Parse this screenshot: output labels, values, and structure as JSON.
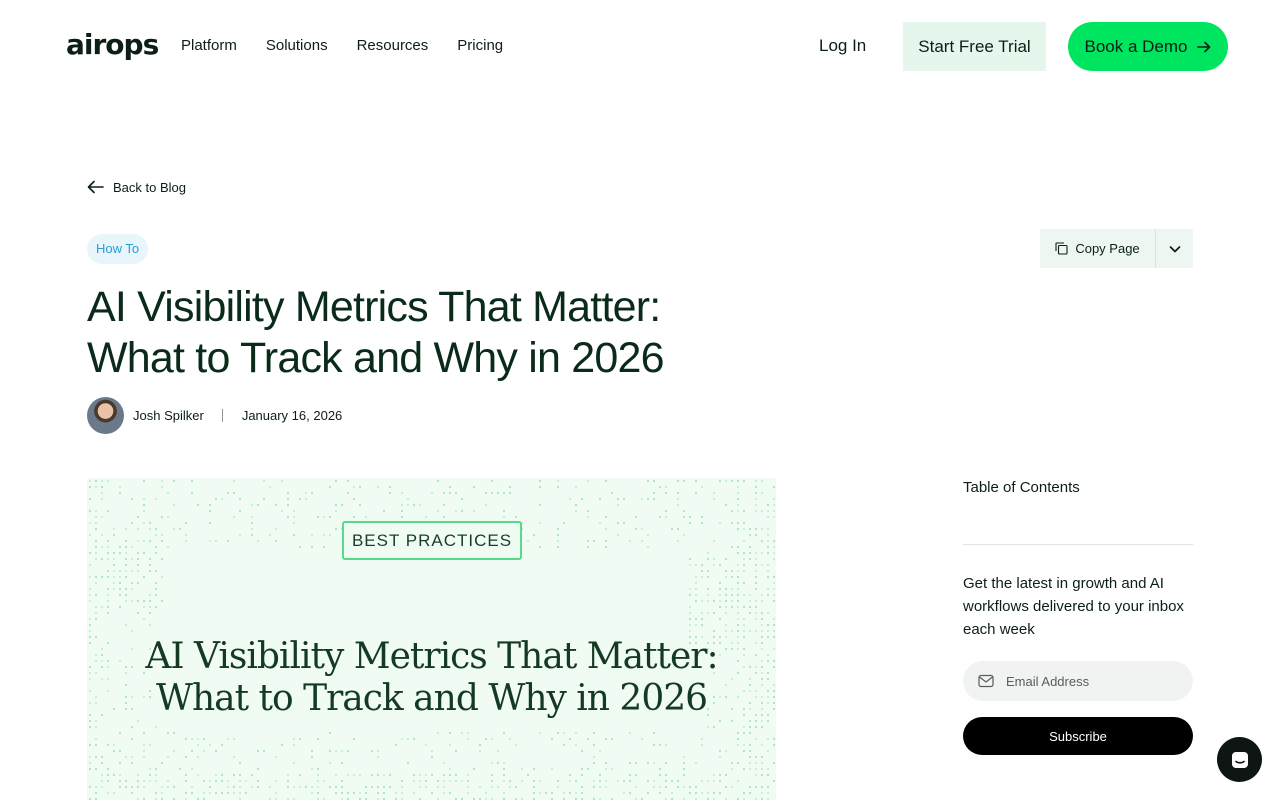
{
  "header": {
    "logo": "airops",
    "nav": [
      "Platform",
      "Solutions",
      "Resources",
      "Pricing"
    ],
    "login_label": "Log In",
    "trial_label": "Start Free Trial",
    "demo_label": "Book a Demo",
    "accent_color": "#00e560"
  },
  "article": {
    "back_label": "Back to Blog",
    "tag": "How To",
    "copy_label": "Copy Page",
    "title": "AI Visibility Metrics That Matter: What to Track and Why in 2026",
    "author": "Josh Spilker",
    "date": "January 16, 2026",
    "hero": {
      "badge": "BEST PRACTICES",
      "title_line1": "AI Visibility Metrics That Matter:",
      "title_line2": "What to Track and Why in 2026"
    }
  },
  "sidebar": {
    "toc_title": "Table of Contents",
    "newsletter_text": "Get the latest in growth and AI workflows delivered to your inbox each week",
    "email_placeholder": "Email Address",
    "subscribe_label": "Subscribe"
  },
  "icons": {
    "back": "arrow-left-icon",
    "copy": "copy-icon",
    "dropdown": "chevron-down-icon",
    "demo": "arrow-right-icon",
    "email": "mail-icon",
    "chat": "chat-icon"
  }
}
